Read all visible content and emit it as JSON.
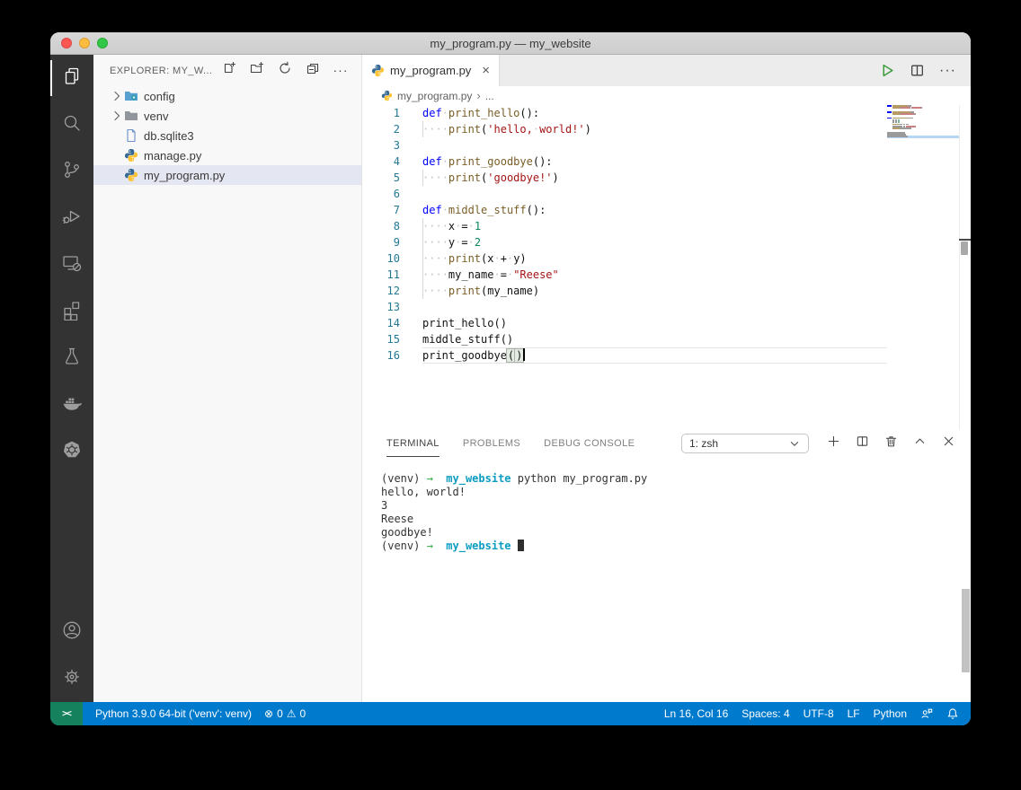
{
  "window": {
    "title": "my_program.py — my_website"
  },
  "colors": {
    "accent": "#007acc",
    "remote_badge": "#16825d",
    "keyword": "#0000ff",
    "function": "#795E26",
    "string": "#a31515",
    "number": "#098658",
    "line_number": "#237893",
    "terminal_arrow": "#31aa3e",
    "terminal_dir": "#0b9dc1",
    "selection_row": "#e4e6f1",
    "activitybar": "#333333"
  },
  "traffic_lights": [
    {
      "name": "close-button"
    },
    {
      "name": "minimize-button"
    },
    {
      "name": "zoom-button"
    }
  ],
  "activity_bar": {
    "top": [
      {
        "name": "activity-explorer",
        "icon": "files-icon",
        "active": true
      },
      {
        "name": "activity-search",
        "icon": "search-icon"
      },
      {
        "name": "activity-source-control",
        "icon": "source-control-icon"
      },
      {
        "name": "activity-run-debug",
        "icon": "debug-icon"
      },
      {
        "name": "activity-remote-explorer",
        "icon": "remote-explorer-icon"
      },
      {
        "name": "activity-extensions",
        "icon": "extensions-icon"
      },
      {
        "name": "activity-testing",
        "icon": "beaker-icon"
      },
      {
        "name": "activity-docker",
        "icon": "docker-icon"
      },
      {
        "name": "activity-kubernetes",
        "icon": "kubernetes-icon"
      }
    ],
    "bottom": [
      {
        "name": "activity-accounts",
        "icon": "account-icon"
      },
      {
        "name": "activity-settings",
        "icon": "gear-icon"
      }
    ]
  },
  "sidebar": {
    "header": "EXPLORER: MY_W...",
    "actions": [
      {
        "name": "new-file-button",
        "icon": "new-file-icon"
      },
      {
        "name": "new-folder-button",
        "icon": "new-folder-icon"
      },
      {
        "name": "refresh-button",
        "icon": "refresh-icon"
      },
      {
        "name": "collapse-folders-button",
        "icon": "collapse-all-icon"
      },
      {
        "name": "views-more-button",
        "icon": "ellipsis-icon"
      }
    ],
    "items": [
      {
        "label": "config",
        "icon": "folder-config-icon",
        "chevron": true
      },
      {
        "label": "venv",
        "icon": "folder-icon",
        "chevron": true
      },
      {
        "label": "db.sqlite3",
        "icon": "database-file-icon",
        "chevron": false
      },
      {
        "label": "manage.py",
        "icon": "python-icon",
        "chevron": false
      },
      {
        "label": "my_program.py",
        "icon": "python-icon",
        "chevron": false,
        "selected": true
      }
    ]
  },
  "editor": {
    "tab": {
      "label": "my_program.py",
      "close": "×"
    },
    "actions": {
      "run_tooltip": "Run Python File",
      "more": "···"
    },
    "breadcrumb": {
      "file": "my_program.py",
      "separator": "›",
      "tail": "..."
    },
    "code": {
      "lines": [
        {
          "num": "1",
          "segs": [
            [
              "k",
              "def"
            ],
            [
              "w",
              "·"
            ],
            [
              "f",
              "print_hello"
            ],
            [
              "p",
              "():"
            ]
          ]
        },
        {
          "num": "2",
          "guide": true,
          "segs": [
            [
              "w",
              "····"
            ],
            [
              "f",
              "print"
            ],
            [
              "p",
              "("
            ],
            [
              "s",
              "'hello,"
            ],
            [
              "w",
              "·"
            ],
            [
              "s",
              "world!'"
            ],
            [
              "p",
              ")"
            ]
          ]
        },
        {
          "num": "3",
          "segs": []
        },
        {
          "num": "4",
          "segs": [
            [
              "k",
              "def"
            ],
            [
              "w",
              "·"
            ],
            [
              "f",
              "print_goodbye"
            ],
            [
              "p",
              "():"
            ]
          ]
        },
        {
          "num": "5",
          "guide": true,
          "segs": [
            [
              "w",
              "····"
            ],
            [
              "f",
              "print"
            ],
            [
              "p",
              "("
            ],
            [
              "s",
              "'goodbye!'"
            ],
            [
              "p",
              ")"
            ]
          ]
        },
        {
          "num": "6",
          "segs": []
        },
        {
          "num": "7",
          "segs": [
            [
              "k",
              "def"
            ],
            [
              "w",
              "·"
            ],
            [
              "f",
              "middle_stuff"
            ],
            [
              "p",
              "():"
            ]
          ]
        },
        {
          "num": "8",
          "guide": true,
          "segs": [
            [
              "w",
              "····"
            ],
            [
              "p",
              "x"
            ],
            [
              "w",
              "·"
            ],
            [
              "p",
              "="
            ],
            [
              "w",
              "·"
            ],
            [
              "n",
              "1"
            ]
          ]
        },
        {
          "num": "9",
          "guide": true,
          "segs": [
            [
              "w",
              "····"
            ],
            [
              "p",
              "y"
            ],
            [
              "w",
              "·"
            ],
            [
              "p",
              "="
            ],
            [
              "w",
              "·"
            ],
            [
              "n",
              "2"
            ]
          ]
        },
        {
          "num": "10",
          "guide": true,
          "segs": [
            [
              "w",
              "····"
            ],
            [
              "f",
              "print"
            ],
            [
              "p",
              "(x"
            ],
            [
              "w",
              "·"
            ],
            [
              "p",
              "+"
            ],
            [
              "w",
              "·"
            ],
            [
              "p",
              "y)"
            ]
          ]
        },
        {
          "num": "11",
          "guide": true,
          "segs": [
            [
              "w",
              "····"
            ],
            [
              "p",
              "my_name"
            ],
            [
              "w",
              "·"
            ],
            [
              "p",
              "="
            ],
            [
              "w",
              "·"
            ],
            [
              "s",
              "\"Reese\""
            ]
          ]
        },
        {
          "num": "12",
          "guide": true,
          "segs": [
            [
              "w",
              "····"
            ],
            [
              "f",
              "print"
            ],
            [
              "p",
              "(my_name)"
            ]
          ]
        },
        {
          "num": "13",
          "segs": []
        },
        {
          "num": "14",
          "segs": [
            [
              "p",
              "print_hello()"
            ]
          ]
        },
        {
          "num": "15",
          "segs": [
            [
              "p",
              "middle_stuff()"
            ]
          ]
        },
        {
          "num": "16",
          "current": true,
          "cursor": true,
          "segs": [
            [
              "p",
              "print_goodbye"
            ],
            [
              "b",
              "("
            ],
            [
              "b",
              ")"
            ]
          ]
        }
      ]
    }
  },
  "panel": {
    "tabs": [
      {
        "label": "TERMINAL",
        "active": true,
        "name": "tab-terminal"
      },
      {
        "label": "PROBLEMS",
        "name": "tab-problems"
      },
      {
        "label": "DEBUG CONSOLE",
        "name": "tab-debug-console"
      }
    ],
    "shell_select": {
      "value": "1: zsh"
    },
    "actions": [
      {
        "name": "new-terminal-button",
        "icon": "plus-icon"
      },
      {
        "name": "split-terminal-button",
        "icon": "split-icon"
      },
      {
        "name": "kill-terminal-button",
        "icon": "trash-icon"
      },
      {
        "name": "maximize-panel-button",
        "icon": "chevron-up-icon"
      },
      {
        "name": "close-panel-button",
        "icon": "close-icon"
      }
    ],
    "terminal_lines": [
      {
        "segs": [
          [
            "p",
            "(venv) "
          ],
          [
            "a",
            "→"
          ],
          [
            "p",
            "  "
          ],
          [
            "d",
            "my_website"
          ],
          [
            "p",
            " python my_program.py"
          ]
        ]
      },
      {
        "segs": [
          [
            "p",
            "hello, world!"
          ]
        ]
      },
      {
        "segs": [
          [
            "p",
            "3"
          ]
        ]
      },
      {
        "segs": [
          [
            "p",
            "Reese"
          ]
        ]
      },
      {
        "segs": [
          [
            "p",
            "goodbye!"
          ]
        ]
      },
      {
        "segs": [
          [
            "p",
            "(venv) "
          ],
          [
            "a",
            "→"
          ],
          [
            "p",
            "  "
          ],
          [
            "d",
            "my_website"
          ],
          [
            "p",
            " "
          ]
        ],
        "cursor": true
      }
    ]
  },
  "status_bar": {
    "remote": {
      "glyph": "><"
    },
    "python_version": "Python 3.9.0 64-bit ('venv': venv)",
    "errors": "0",
    "warnings": "0",
    "error_glyph": "⊗",
    "warning_glyph": "⚠",
    "line_col": "Ln 16, Col 16",
    "indent": "Spaces: 4",
    "encoding": "UTF-8",
    "eol": "LF",
    "language": "Python"
  }
}
